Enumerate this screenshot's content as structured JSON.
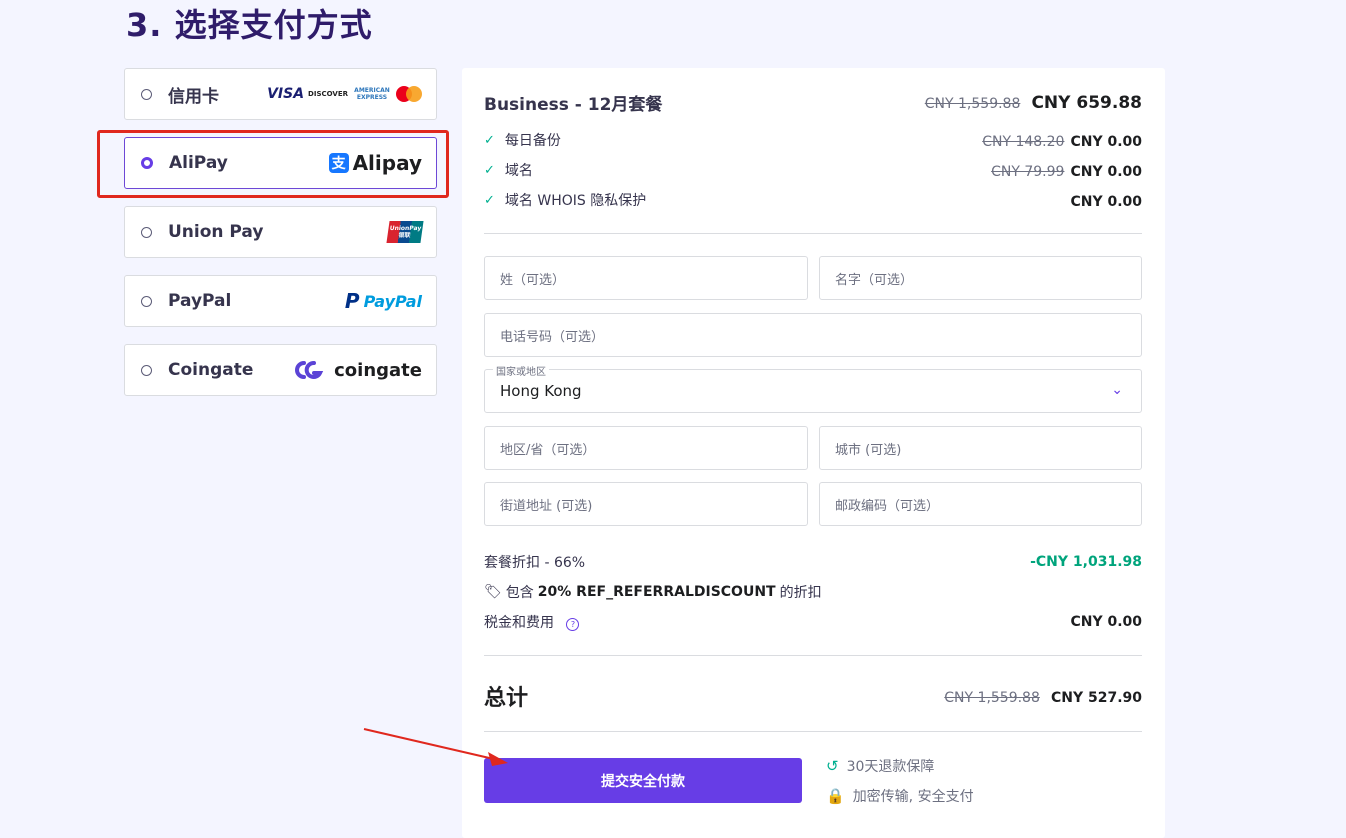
{
  "page_title": "3. 选择支付方式",
  "payment_methods": [
    {
      "label": "信用卡",
      "selected": false,
      "logos": [
        "VISA",
        "DISCOVER",
        "AMERICAN EXPRESS",
        "mastercard-icon"
      ]
    },
    {
      "label": "AliPay",
      "selected": true,
      "logos": [
        "Alipay"
      ]
    },
    {
      "label": "Union Pay",
      "selected": false,
      "logos": [
        "UnionPay 银联"
      ]
    },
    {
      "label": "PayPal",
      "selected": false,
      "logos": [
        "PayPal"
      ]
    },
    {
      "label": "Coingate",
      "selected": false,
      "logos": [
        "coingate"
      ]
    }
  ],
  "order": {
    "plan_name": "Business - 12月套餐",
    "plan_old_price": "CNY 1,559.88",
    "plan_price": "CNY 659.88",
    "features": [
      {
        "label": "每日备份",
        "old_price": "CNY 148.20",
        "price": "CNY 0.00"
      },
      {
        "label": "域名",
        "old_price": "CNY 79.99",
        "price": "CNY 0.00"
      },
      {
        "label": "域名 WHOIS 隐私保护",
        "old_price": "",
        "price": "CNY 0.00"
      }
    ]
  },
  "form": {
    "last_name_placeholder": "姓（可选）",
    "first_name_placeholder": "名字（可选）",
    "phone_placeholder": "电话号码（可选）",
    "country_label": "国家或地区",
    "country_value": "Hong Kong",
    "region_placeholder": "地区/省（可选）",
    "city_placeholder": "城市 (可选)",
    "street_placeholder": "街道地址 (可选)",
    "zip_placeholder": "邮政编码（可选）"
  },
  "summary": {
    "discount_label": "套餐折扣 - 66%",
    "discount_value": "-CNY 1,031.98",
    "coupon_prefix": "包含",
    "coupon_code": "20% REF_REFERRALDISCOUNT",
    "coupon_suffix": "的折扣",
    "tax_label": "税金和费用",
    "tax_value": "CNY 0.00",
    "total_label": "总计",
    "total_old": "CNY 1,559.88",
    "total_value": "CNY 527.90"
  },
  "submit_label": "提交安全付款",
  "guarantees": [
    "30天退款保障",
    "加密传输, 安全支付"
  ],
  "colors": {
    "accent": "#673de6",
    "success": "#00b090",
    "highlight": "#e0281e"
  }
}
